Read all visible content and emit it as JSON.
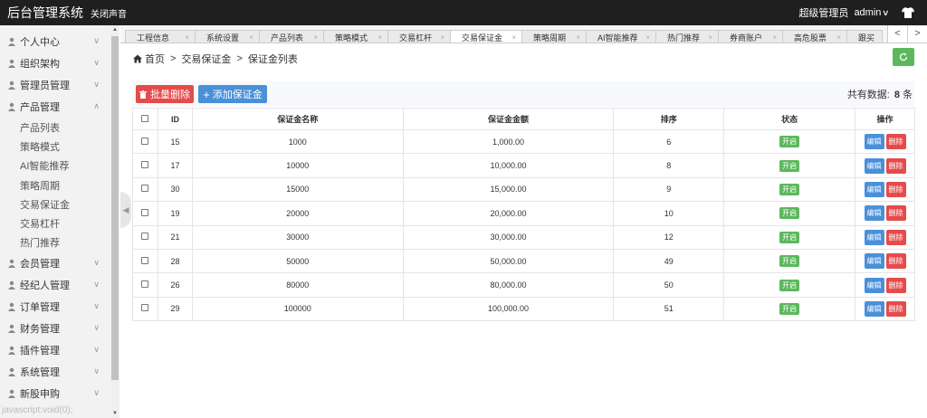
{
  "topbar": {
    "app_title": "后台管理系统",
    "mute_link": "关闭声音",
    "role": "超级管理员",
    "username": "admin"
  },
  "sidebar": {
    "items": [
      {
        "label": "个人中心",
        "icon": "user-icon",
        "arrow": "∨"
      },
      {
        "label": "组织架构",
        "icon": "org-icon",
        "arrow": "∨"
      },
      {
        "label": "管理员管理",
        "icon": "admin-icon",
        "arrow": "∨"
      },
      {
        "label": "产品管理",
        "icon": "product-icon",
        "arrow": "∧"
      }
    ],
    "sub_items": [
      "产品列表",
      "策略模式",
      "AI智能推荐",
      "策略周期",
      "交易保证金",
      "交易杠杆",
      "热门推荐"
    ],
    "items_after": [
      {
        "label": "会员管理",
        "icon": "member-icon",
        "arrow": "∨"
      },
      {
        "label": "经纪人管理",
        "icon": "broker-icon",
        "arrow": "∨"
      },
      {
        "label": "订单管理",
        "icon": "order-icon",
        "arrow": "∨"
      },
      {
        "label": "财务管理",
        "icon": "finance-icon",
        "arrow": "∨"
      },
      {
        "label": "插件管理",
        "icon": "plugin-icon",
        "arrow": "∨"
      },
      {
        "label": "系统管理",
        "icon": "gear-icon",
        "arrow": "∨"
      },
      {
        "label": "新股申购",
        "icon": "ipo-icon",
        "arrow": "∨"
      }
    ],
    "status_link": "javascript:void(0);"
  },
  "tabs": [
    {
      "label": "工程信息",
      "close": "×"
    },
    {
      "label": "系统设置",
      "close": "×"
    },
    {
      "label": "产品列表",
      "close": "×"
    },
    {
      "label": "策略模式",
      "close": "×"
    },
    {
      "label": "交易杠杆",
      "close": "×"
    },
    {
      "label": "交易保证金",
      "close": "×",
      "active": true
    },
    {
      "label": "策略周期",
      "close": "×"
    },
    {
      "label": "AI智能推荐",
      "close": "×"
    },
    {
      "label": "热门推荐",
      "close": "×"
    },
    {
      "label": "券商账户",
      "close": "×"
    },
    {
      "label": "高危股票",
      "close": "×"
    },
    {
      "label": "跟买",
      "close": ""
    }
  ],
  "tab_nav": {
    "prev": "<",
    "next": ">"
  },
  "breadcrumb": {
    "home": "首页",
    "sep": ">",
    "level1": "交易保证金",
    "level2": "保证金列表"
  },
  "toolbar": {
    "batch_delete": "批量删除",
    "add": "添加保证金",
    "total_prefix": "共有数据:",
    "total_count": "8",
    "total_suffix": "条"
  },
  "table": {
    "headers": [
      "ID",
      "保证金名称",
      "保证金金额",
      "排序",
      "状态",
      "操作"
    ],
    "rows": [
      {
        "id": "15",
        "name": "1000",
        "amount": "1,000.00",
        "sort": "6",
        "status": "开启"
      },
      {
        "id": "17",
        "name": "10000",
        "amount": "10,000.00",
        "sort": "8",
        "status": "开启"
      },
      {
        "id": "30",
        "name": "15000",
        "amount": "15,000.00",
        "sort": "9",
        "status": "开启"
      },
      {
        "id": "19",
        "name": "20000",
        "amount": "20,000.00",
        "sort": "10",
        "status": "开启"
      },
      {
        "id": "21",
        "name": "30000",
        "amount": "30,000.00",
        "sort": "12",
        "status": "开启"
      },
      {
        "id": "28",
        "name": "50000",
        "amount": "50,000.00",
        "sort": "49",
        "status": "开启"
      },
      {
        "id": "26",
        "name": "80000",
        "amount": "80,000.00",
        "sort": "50",
        "status": "开启"
      },
      {
        "id": "29",
        "name": "100000",
        "amount": "100,000.00",
        "sort": "51",
        "status": "开启"
      }
    ],
    "edit_label": "编辑",
    "delete_label": "删除"
  },
  "colors": {
    "topbar": "#1f1f1f",
    "danger": "#e54b4b",
    "primary": "#4a90d9",
    "success": "#5cb85c"
  }
}
